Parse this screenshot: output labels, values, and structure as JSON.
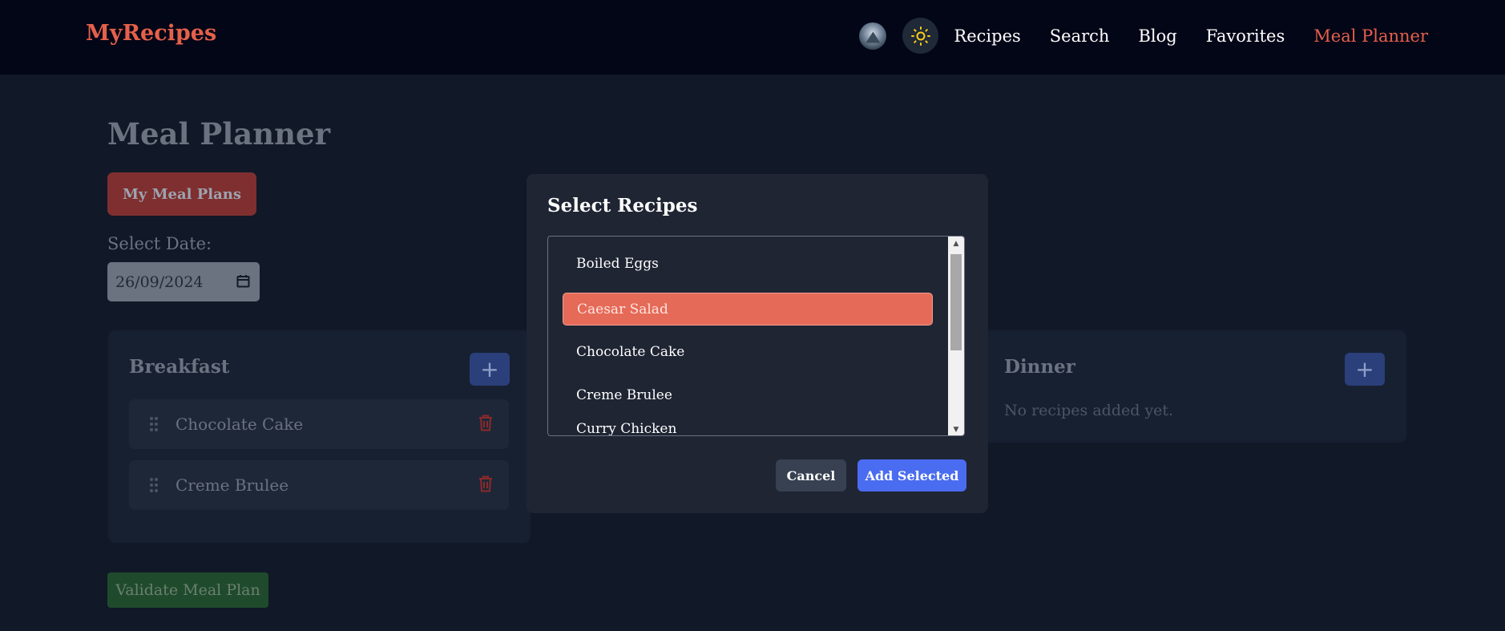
{
  "header": {
    "logo": "MyRecipes",
    "theme_icon": "sun-icon",
    "nav": [
      "Recipes",
      "Search",
      "Blog",
      "Favorites",
      "Meal Planner"
    ],
    "active_nav": "Meal Planner",
    "accent_color": "#e5604a"
  },
  "page": {
    "title": "Meal Planner",
    "my_plans_button": "My Meal Plans",
    "date_label": "Select Date:",
    "date_value": "26/09/2024",
    "validate_button": "Validate Meal Plan"
  },
  "breakfast": {
    "title": "Breakfast",
    "add_label": "+",
    "items": [
      "Chocolate Cake",
      "Creme Brulee"
    ]
  },
  "dinner": {
    "title": "Dinner",
    "add_label": "+",
    "empty_text": "No recipes added yet."
  },
  "modal": {
    "title": "Select Recipes",
    "options": [
      "Boiled Eggs",
      "Caesar Salad",
      "Chocolate Cake",
      "Creme Brulee",
      "Curry Chicken"
    ],
    "selected": "Caesar Salad",
    "cancel_button": "Cancel",
    "add_button": "Add Selected"
  }
}
